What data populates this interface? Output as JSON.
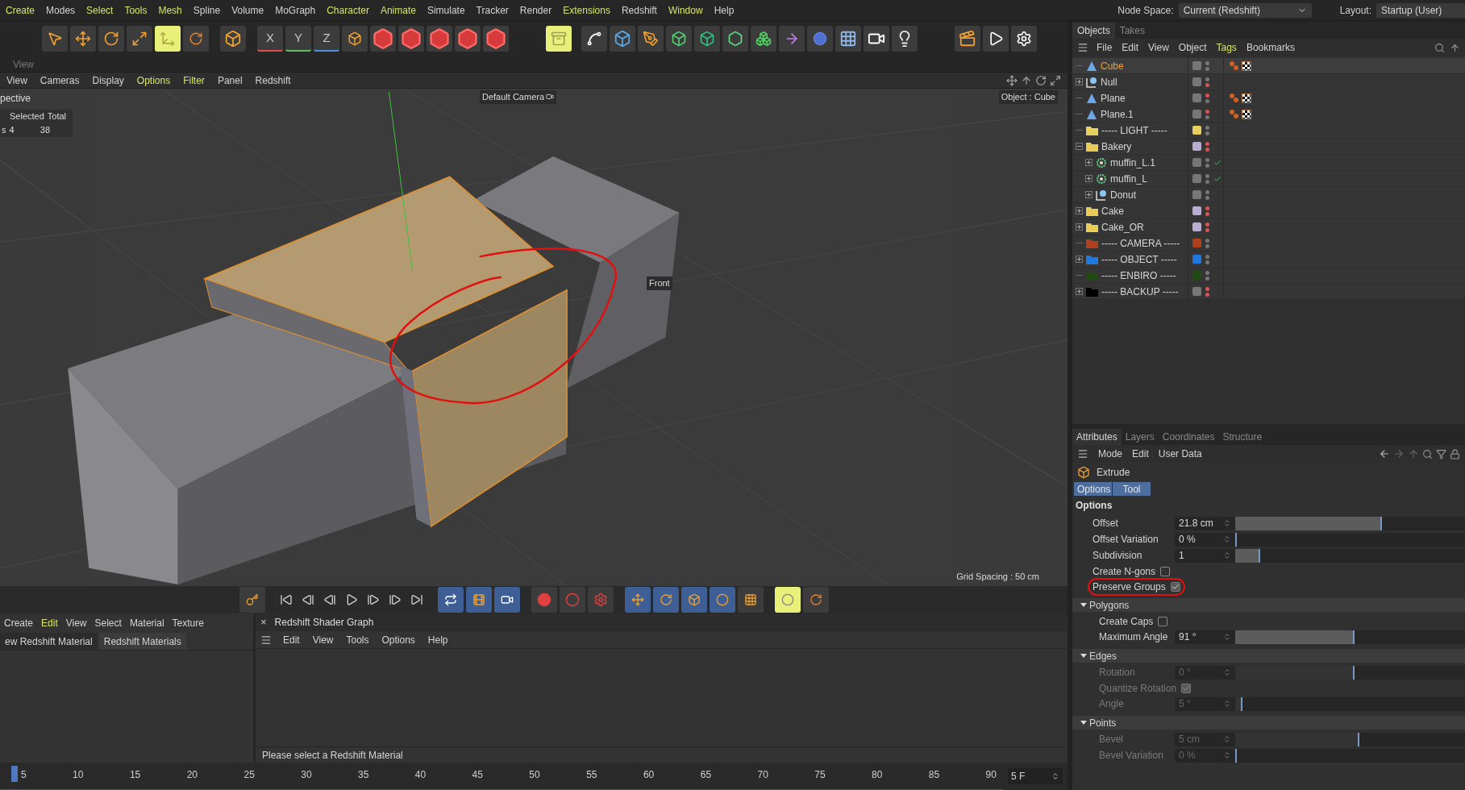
{
  "menu_bar": [
    {
      "label": "Create",
      "highlighted": true
    },
    {
      "label": "Modes",
      "highlighted": false
    },
    {
      "label": "Select",
      "highlighted": true
    },
    {
      "label": "Tools",
      "highlighted": true
    },
    {
      "label": "Mesh",
      "highlighted": true
    },
    {
      "label": "Spline",
      "highlighted": false
    },
    {
      "label": "Volume",
      "highlighted": false
    },
    {
      "label": "MoGraph",
      "highlighted": false
    },
    {
      "label": "Character",
      "highlighted": true
    },
    {
      "label": "Animate",
      "highlighted": true
    },
    {
      "label": "Simulate",
      "highlighted": false
    },
    {
      "label": "Tracker",
      "highlighted": false
    },
    {
      "label": "Render",
      "highlighted": false
    },
    {
      "label": "Extensions",
      "highlighted": true
    },
    {
      "label": "Redshift",
      "highlighted": false
    },
    {
      "label": "Window",
      "highlighted": true
    },
    {
      "label": "Help",
      "highlighted": false
    }
  ],
  "node_space": {
    "label": "Node Space:",
    "value": "Current (Redshift)"
  },
  "layout": {
    "label": "Layout:",
    "value": "Startup (User)"
  },
  "toolbar": {
    "axis_locks": [
      "X",
      "Y",
      "Z"
    ]
  },
  "view_tab": "View",
  "viewport": {
    "menu": [
      {
        "label": "View",
        "highlighted": false
      },
      {
        "label": "Cameras",
        "highlighted": false
      },
      {
        "label": "Display",
        "highlighted": false
      },
      {
        "label": "Options",
        "highlighted": true
      },
      {
        "label": "Filter",
        "highlighted": true
      },
      {
        "label": "Panel",
        "highlighted": false
      },
      {
        "label": "Redshift",
        "highlighted": false
      }
    ],
    "projection": "pective",
    "stats_headers": [
      "Selected",
      "Total"
    ],
    "stats_row": [
      "s",
      "4",
      "38"
    ],
    "camera_label": "Default Camera",
    "object_label": "Object : Cube",
    "front_label": "Front",
    "grid_spacing": "Grid Spacing : 50 cm"
  },
  "material_manager": {
    "menu": [
      {
        "label": "Create",
        "highlighted": false
      },
      {
        "label": "Edit",
        "highlighted": true
      },
      {
        "label": "View",
        "highlighted": false
      },
      {
        "label": "Select",
        "highlighted": false
      },
      {
        "label": "Material",
        "highlighted": false
      },
      {
        "label": "Texture",
        "highlighted": false
      }
    ],
    "buttons": [
      "ew Redshift Material",
      "Redshift Materials"
    ]
  },
  "shader_graph": {
    "close": "×",
    "title": "Redshift Shader Graph",
    "menu": [
      "Edit",
      "View",
      "Tools",
      "Options",
      "Help"
    ],
    "status": "Please select a Redshift Material"
  },
  "timeline": {
    "ticks": [
      "5",
      "10",
      "15",
      "20",
      "25",
      "30",
      "35",
      "40",
      "45",
      "50",
      "55",
      "60",
      "65",
      "70",
      "75",
      "80",
      "85",
      "90"
    ],
    "frame": "5 F"
  },
  "objects": {
    "tabs": [
      {
        "label": "Objects",
        "selected": true
      },
      {
        "label": "Takes",
        "selected": false
      }
    ],
    "menu": [
      {
        "label": "File",
        "highlighted": false
      },
      {
        "label": "Edit",
        "highlighted": false
      },
      {
        "label": "View",
        "highlighted": false
      },
      {
        "label": "Object",
        "highlighted": false
      },
      {
        "label": "Tags",
        "highlighted": true
      },
      {
        "label": "Bookmarks",
        "highlighted": false
      }
    ],
    "items": [
      {
        "name": "Cube",
        "kind": "polygon",
        "selected": true,
        "editor_hidden": false,
        "render_hidden": false,
        "tags": [
          {
            "kind": "material"
          },
          {
            "kind": "texture"
          }
        ]
      },
      {
        "name": "Null",
        "kind": "null",
        "selected": false,
        "expanded": false,
        "editor_hidden": false,
        "render_hidden": true
      },
      {
        "name": "Plane",
        "kind": "polygon",
        "selected": false,
        "editor_hidden": true,
        "render_hidden": false,
        "tags": [
          {
            "kind": "material"
          },
          {
            "kind": "texture"
          }
        ]
      },
      {
        "name": "Plane.1",
        "kind": "polygon",
        "selected": false,
        "editor_hidden": true,
        "render_hidden": false,
        "tags": [
          {
            "kind": "material"
          },
          {
            "kind": "texture"
          }
        ]
      },
      {
        "name": "----- LIGHT -----",
        "kind": "layer_folder",
        "color": "#e8d060",
        "selected": false,
        "editor_hidden": false,
        "render_hidden": false
      },
      {
        "name": "Bakery",
        "kind": "folder",
        "color": "#b8aed0",
        "selected": false,
        "expanded": true,
        "editor_hidden": true,
        "render_hidden": true,
        "children": [
          {
            "name": "muffin_L.1",
            "kind": "generator",
            "selected": false,
            "expanded": false,
            "editor_hidden": false,
            "render_hidden": false,
            "check": true
          },
          {
            "name": "muffin_L",
            "kind": "generator",
            "selected": false,
            "expanded": false,
            "editor_hidden": false,
            "render_hidden": false,
            "check": true
          },
          {
            "name": "Donut",
            "kind": "null",
            "selected": false,
            "expanded": false,
            "editor_hidden": false,
            "render_hidden": false
          }
        ]
      },
      {
        "name": "Cake",
        "kind": "folder",
        "color": "#b8aed0",
        "selected": false,
        "expanded": false,
        "editor_hidden": true,
        "render_hidden": true
      },
      {
        "name": "Cake_OR",
        "kind": "folder",
        "color": "#b8aed0",
        "selected": false,
        "expanded": false,
        "editor_hidden": true,
        "render_hidden": true
      },
      {
        "name": "----- CAMERA -----",
        "kind": "layer_folder",
        "color": "#b0401c",
        "selected": false,
        "editor_hidden": false,
        "render_hidden": false
      },
      {
        "name": "----- OBJECT -----",
        "kind": "layer_folder",
        "color": "#1e78e0",
        "selected": false,
        "expanded": false,
        "editor_hidden": false,
        "render_hidden": false
      },
      {
        "name": "----- ENBIRO -----",
        "kind": "layer_folder",
        "color": "#1f4a10",
        "selected": false,
        "editor_hidden": false,
        "render_hidden": false
      },
      {
        "name": "----- BACKUP -----",
        "kind": "dark_folder",
        "selected": false,
        "expanded": false,
        "editor_hidden": true,
        "render_hidden": true
      }
    ]
  },
  "attributes": {
    "tabs": [
      {
        "label": "Attributes",
        "selected": true
      },
      {
        "label": "Layers",
        "selected": false
      },
      {
        "label": "Coordinates",
        "selected": false
      },
      {
        "label": "Structure",
        "selected": false
      }
    ],
    "menu": [
      "Mode",
      "Edit",
      "User Data"
    ],
    "tool": "Extrude",
    "subtabs": [
      {
        "label": "Options",
        "selected": true
      },
      {
        "label": "Tool",
        "selected": true
      }
    ],
    "section": "Options",
    "fields": [
      {
        "kind": "number",
        "label": "Offset",
        "value": "21.8 cm",
        "level": 0.64,
        "disabled": false,
        "indent": false
      },
      {
        "kind": "number",
        "label": "Offset Variation",
        "value": "0 %",
        "level": 0.0,
        "disabled": false,
        "indent": false
      },
      {
        "kind": "number",
        "label": "Subdivision",
        "value": "1",
        "level": 0.11,
        "disabled": false,
        "indent": false
      },
      {
        "kind": "checkbox",
        "label": "Create N-gons",
        "checked": false,
        "disabled": false,
        "indent": false
      },
      {
        "kind": "checkbox",
        "label": "Preserve Groups",
        "checked": true,
        "disabled": false,
        "indent": false,
        "circled": true
      },
      {
        "kind": "section",
        "label": "Polygons",
        "expanded": true
      },
      {
        "kind": "checkbox",
        "label": "Create Caps",
        "checked": false,
        "disabled": false,
        "indent": true
      },
      {
        "kind": "number",
        "label": "Maximum Angle",
        "value": "91 °",
        "level": 0.52,
        "disabled": false,
        "indent": true
      },
      {
        "kind": "section",
        "label": "Edges",
        "expanded": true
      },
      {
        "kind": "number",
        "label": "Rotation",
        "value": "0 °",
        "level": 0.52,
        "disabled": true,
        "indent": true
      },
      {
        "kind": "checkbox",
        "label": "Quantize Rotation",
        "checked": true,
        "disabled": true,
        "indent": true
      },
      {
        "kind": "number",
        "label": "Angle",
        "value": "5 °",
        "level": 0.03,
        "disabled": true,
        "indent": true
      },
      {
        "kind": "section",
        "label": "Points",
        "expanded": true
      },
      {
        "kind": "number",
        "label": "Bevel",
        "value": "5 cm",
        "level": 0.54,
        "disabled": true,
        "indent": true
      },
      {
        "kind": "number",
        "label": "Bevel Variation",
        "value": "0 %",
        "level": 0.0,
        "disabled": true,
        "indent": true
      }
    ]
  }
}
